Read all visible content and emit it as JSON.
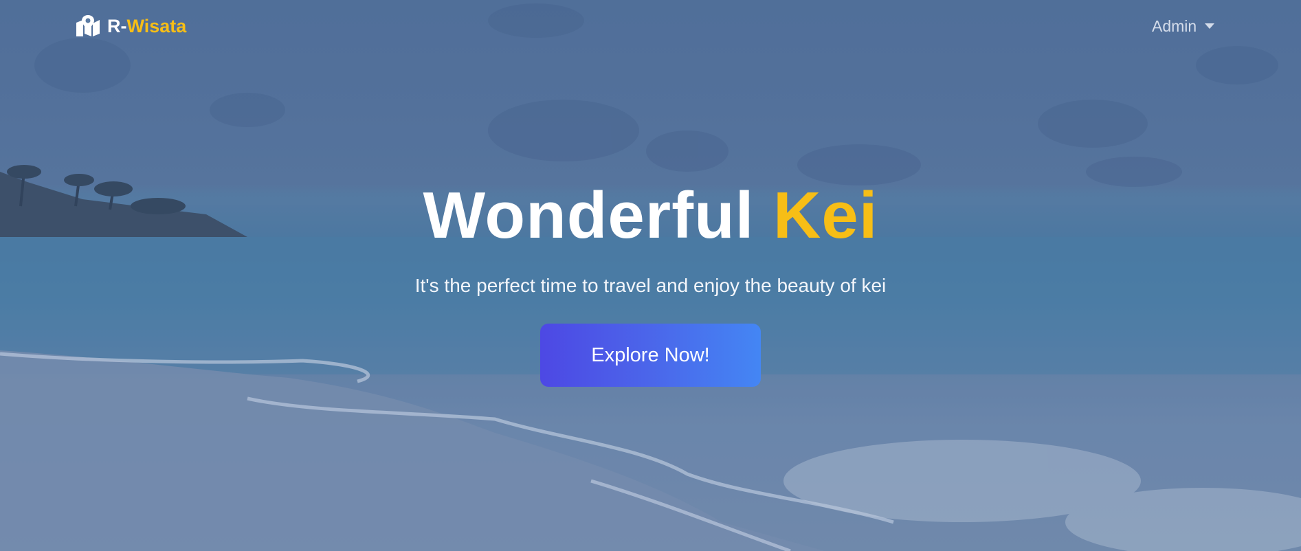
{
  "navbar": {
    "brand": {
      "prefix": "R-",
      "accent": "Wisata",
      "icon": "map-marker-icon"
    },
    "admin_menu": {
      "label": "Admin",
      "icon": "caret-down-icon"
    }
  },
  "hero": {
    "title_main": "Wonderful",
    "title_accent": "Kei",
    "subtitle": "It's the perfect time to travel and enjoy the beauty of kei",
    "cta_label": "Explore Now!"
  },
  "colors": {
    "accent_yellow": "#f7be16",
    "button_gradient_start": "#4d48e4",
    "button_gradient_end": "#4486f4",
    "text_white": "#ffffff"
  }
}
